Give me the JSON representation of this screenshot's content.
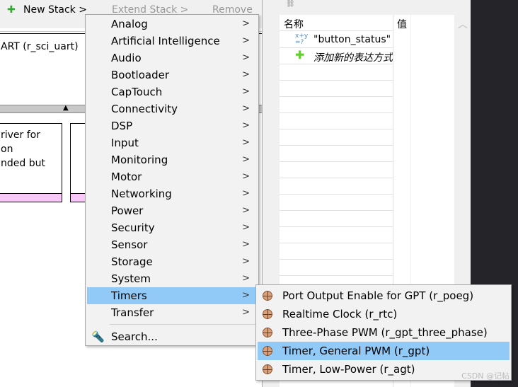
{
  "toolbar": {
    "new_stack": "New Stack >",
    "extend_stack": "Extend Stack >",
    "remove": "Remove"
  },
  "left": {
    "uart_text": "ART (r_sci_uart)",
    "card_text": [
      "river for",
      "on",
      "nded but"
    ]
  },
  "expressions": {
    "col_name": "名称",
    "col_value": "值",
    "rows": [
      {
        "name": "\"button_status\"",
        "icon": "expression-icon"
      },
      {
        "name": "添加新的表达方式",
        "icon": "plus-icon",
        "italic": true
      }
    ]
  },
  "menu": {
    "items": [
      "Analog",
      "Artificial Intelligence",
      "Audio",
      "Bootloader",
      "CapTouch",
      "Connectivity",
      "DSP",
      "Input",
      "Monitoring",
      "Motor",
      "Networking",
      "Power",
      "Security",
      "Sensor",
      "Storage",
      "System",
      "Timers",
      "Transfer"
    ],
    "highlighted": "Timers",
    "search": "Search..."
  },
  "submenu": {
    "items": [
      "Port Output Enable for GPT (r_poeg)",
      "Realtime Clock (r_rtc)",
      "Three-Phase PWM (r_gpt_three_phase)",
      "Timer, General PWM (r_gpt)",
      "Timer, Low-Power (r_agt)"
    ],
    "highlighted": "Timer, General PWM (r_gpt)"
  },
  "watermark": "CSDN @记帖",
  "colors": {
    "highlight": "#91c9f7",
    "menu_bg": "#f2f2f2",
    "pink": "#f8c8f8",
    "dark": "#252529"
  }
}
